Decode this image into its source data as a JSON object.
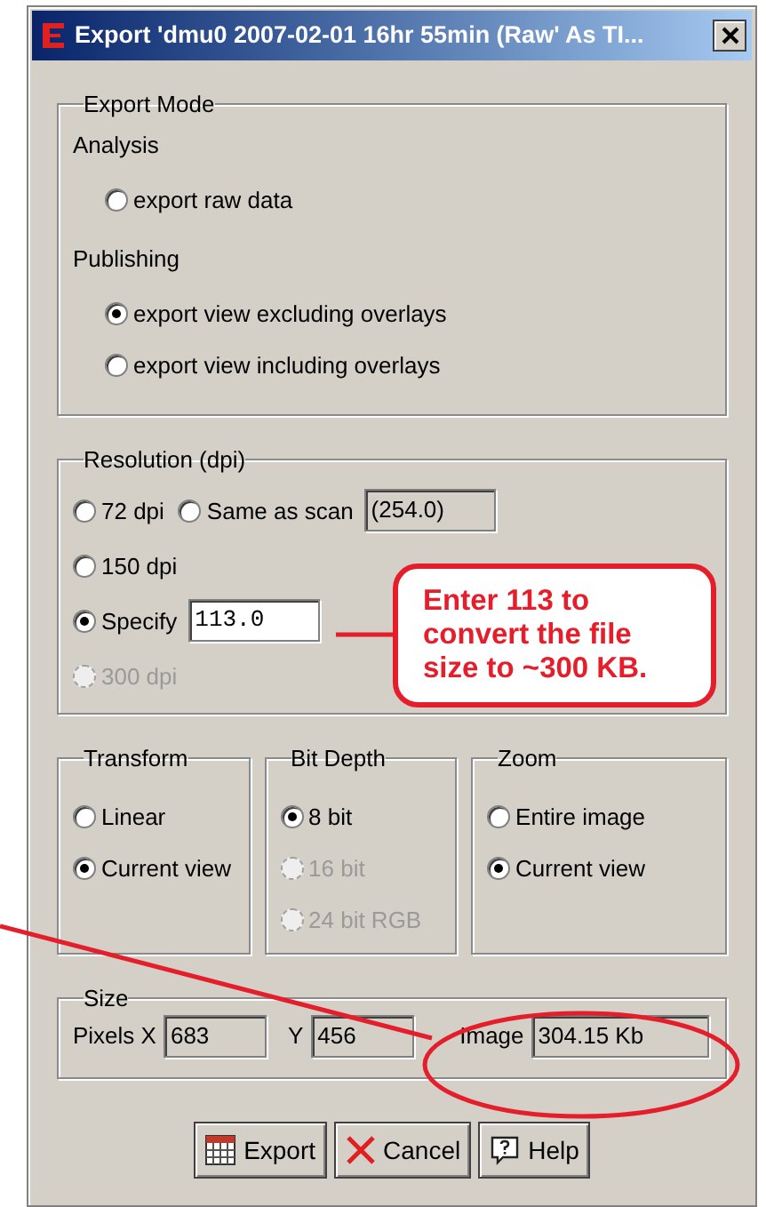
{
  "window": {
    "title": "Export 'dmu0 2007-02-01 16hr 55min (Raw' As TI..."
  },
  "export_mode": {
    "legend": "Export Mode",
    "sections": [
      {
        "heading": "Analysis",
        "options": [
          {
            "label": "export raw data",
            "selected": false
          }
        ]
      },
      {
        "heading": "Publishing",
        "options": [
          {
            "label": "export view excluding overlays",
            "selected": true
          },
          {
            "label": "export view including overlays",
            "selected": false
          }
        ]
      }
    ]
  },
  "resolution": {
    "legend": "Resolution (dpi)",
    "rows": [
      [
        {
          "label": "72 dpi",
          "selected": false,
          "disabled": false
        },
        {
          "label": "Same as scan",
          "selected": false,
          "disabled": false,
          "readout": "(254.0)"
        }
      ],
      [
        {
          "label": "150 dpi",
          "selected": false,
          "disabled": false
        }
      ],
      [
        {
          "label": "Specify",
          "selected": true,
          "disabled": false,
          "input": "113.0"
        }
      ],
      [
        {
          "label": "300 dpi",
          "selected": false,
          "disabled": true
        }
      ]
    ]
  },
  "option_groups": [
    {
      "legend": "Transform",
      "options": [
        {
          "label": "Linear",
          "selected": false,
          "disabled": false
        },
        {
          "label": "Current view",
          "selected": true,
          "disabled": false
        }
      ]
    },
    {
      "legend": "Bit Depth",
      "options": [
        {
          "label": "8 bit",
          "selected": true,
          "disabled": false
        },
        {
          "label": "16 bit",
          "selected": false,
          "disabled": true
        },
        {
          "label": "24 bit RGB",
          "selected": false,
          "disabled": true
        }
      ]
    },
    {
      "legend": "Zoom",
      "options": [
        {
          "label": "Entire image",
          "selected": false,
          "disabled": false
        },
        {
          "label": "Current view",
          "selected": true,
          "disabled": false
        }
      ]
    }
  ],
  "size": {
    "legend": "Size",
    "fields": [
      {
        "label": "Pixels X",
        "value": "683"
      },
      {
        "label": "Y",
        "value": "456"
      },
      {
        "label": "Image",
        "value": "304.15 Kb"
      }
    ]
  },
  "buttons": [
    {
      "label": "Export",
      "kind": "export"
    },
    {
      "label": "Cancel",
      "kind": "cancel"
    },
    {
      "label": "Help",
      "kind": "help"
    }
  ],
  "annotation": {
    "callout": "Enter 113 to\nconvert the file\nsize to ~300 KB."
  }
}
